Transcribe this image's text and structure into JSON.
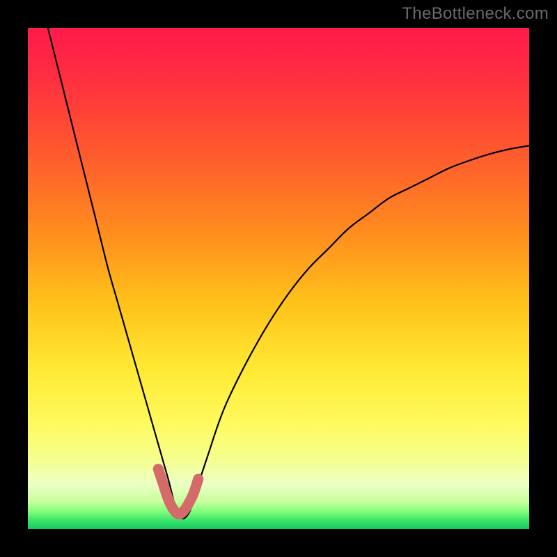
{
  "watermark": "TheBottleneck.com",
  "colors": {
    "frame": "#000000",
    "curve": "#000000",
    "marker": "#d46a6a",
    "marker_fill": "#d46a6a"
  },
  "gradient_stops": [
    {
      "offset": 0.0,
      "color": "#ff1a4b"
    },
    {
      "offset": 0.1,
      "color": "#ff2f3f"
    },
    {
      "offset": 0.25,
      "color": "#ff5a2e"
    },
    {
      "offset": 0.4,
      "color": "#ff8a1f"
    },
    {
      "offset": 0.55,
      "color": "#ffc21a"
    },
    {
      "offset": 0.68,
      "color": "#ffe933"
    },
    {
      "offset": 0.78,
      "color": "#fff95a"
    },
    {
      "offset": 0.86,
      "color": "#f6ff8e"
    },
    {
      "offset": 0.91,
      "color": "#ecffc4"
    },
    {
      "offset": 0.945,
      "color": "#c8ff9c"
    },
    {
      "offset": 0.965,
      "color": "#7fff7a"
    },
    {
      "offset": 0.985,
      "color": "#34e06a"
    },
    {
      "offset": 1.0,
      "color": "#15c85e"
    }
  ],
  "chart_data": {
    "type": "line",
    "title": "",
    "xlabel": "",
    "ylabel": "",
    "xlim": [
      0,
      100
    ],
    "ylim": [
      0,
      100
    ],
    "minimum_x": 30,
    "series": [
      {
        "name": "bottleneck-curve",
        "x": [
          4,
          6,
          8,
          10,
          12,
          14,
          16,
          18,
          20,
          22,
          24,
          26,
          28,
          30,
          32,
          34,
          36,
          38,
          40,
          44,
          48,
          52,
          56,
          60,
          64,
          68,
          72,
          76,
          80,
          84,
          88,
          92,
          96,
          100
        ],
        "y": [
          100,
          92,
          84,
          76,
          68,
          60,
          52,
          45,
          38,
          31,
          24,
          17,
          10,
          3,
          3,
          9,
          15,
          21,
          26,
          34,
          41,
          47,
          52,
          56,
          60,
          63,
          66,
          68,
          70,
          72,
          73.5,
          74.8,
          75.8,
          76.5
        ]
      }
    ],
    "markers": {
      "name": "near-minimum",
      "x": [
        26,
        27,
        28,
        29,
        30,
        31,
        32,
        33,
        34
      ],
      "y": [
        12,
        9,
        6,
        4,
        3,
        3.5,
        5,
        7,
        10
      ]
    }
  }
}
